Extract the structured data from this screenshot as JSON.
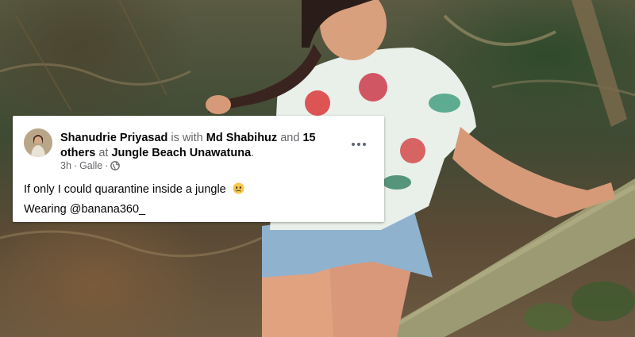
{
  "post": {
    "author": "Shanudrie Priyasad",
    "with_text": "is with",
    "tagged_person": "Md Shabihuz",
    "and_text": "and",
    "others": "15 others",
    "at_text": "at",
    "location": "Jungle Beach Unawatuna",
    "period": ".",
    "time": "3h",
    "separator": "·",
    "place": "Galle",
    "separator2": "·",
    "audience_icon": "globe-icon",
    "text_line1": "If only I could quarantine inside a jungle",
    "emoji": "sad-face-emoji",
    "text_line2": "Wearing @banana360_",
    "menu_icon": "more-options-icon"
  },
  "colors": {
    "card_bg": "#ffffff",
    "name_text": "#050505",
    "meta_text": "#65676b"
  }
}
